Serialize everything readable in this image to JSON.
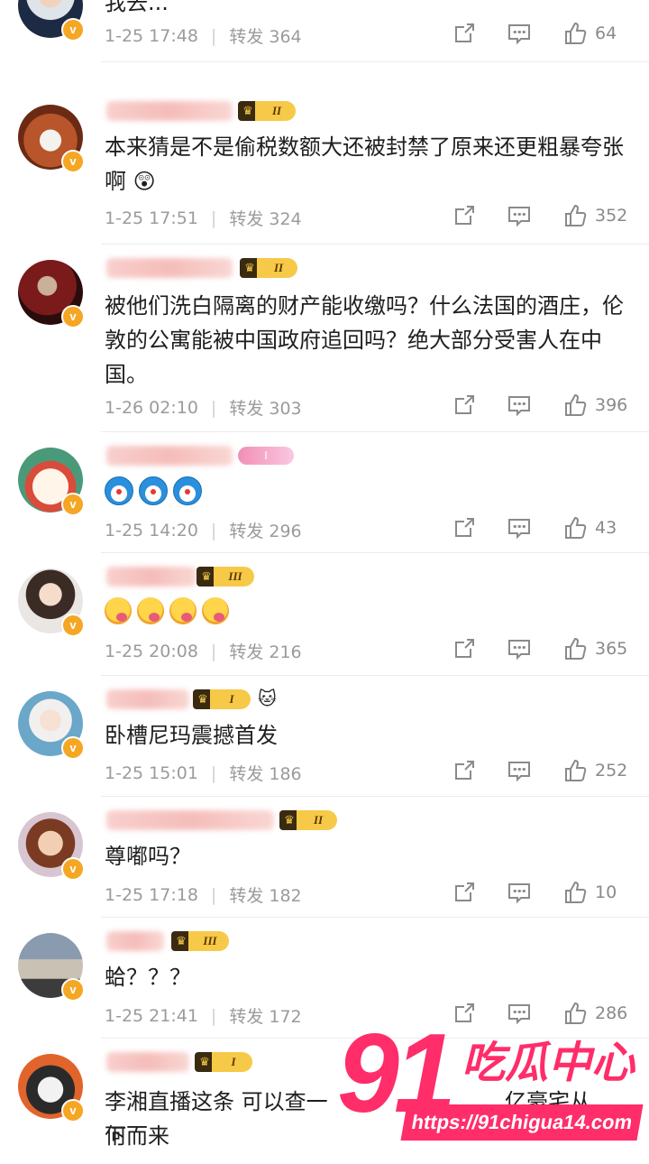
{
  "comments": [
    {
      "text": "我去...",
      "time": "1-25 17:48",
      "repost": "转发 364",
      "likes": "64",
      "avatar": "avatar-suit-man",
      "badge": null,
      "emojis": []
    },
    {
      "text": "本来猜是不是偷税数额大还被封禁了原来还更粗暴夸张啊",
      "time": "1-25 17:51",
      "repost": "转发 324",
      "likes": "352",
      "avatar": "avatar-red-panda",
      "badge": "II",
      "emojis": []
    },
    {
      "text": "被他们洗白隔离的财产能收缴吗？什么法国的酒庄，伦敦的公寓能被中国政府追回吗？绝大部分受害人在中国。",
      "time": "1-26 02:10",
      "repost": "转发 303",
      "likes": "396",
      "avatar": "avatar-red-figure",
      "badge": "II",
      "emojis": []
    },
    {
      "text": "",
      "time": "1-25 14:20",
      "repost": "转发 296",
      "likes": "43",
      "avatar": "avatar-cartoon-cat",
      "badge": "I",
      "emojis": [
        "doraemon",
        "doraemon",
        "doraemon"
      ]
    },
    {
      "text": "",
      "time": "1-25 20:08",
      "repost": "转发 216",
      "likes": "365",
      "avatar": "avatar-girl-white",
      "badge": "III",
      "emojis": [
        "yum",
        "yum",
        "yum",
        "yum"
      ]
    },
    {
      "text": "卧槽尼玛震撼首发",
      "time": "1-25 15:01",
      "repost": "转发 186",
      "likes": "252",
      "avatar": "avatar-girl-hat",
      "badge": "I",
      "emojis": []
    },
    {
      "text": "尊嘟吗？",
      "time": "1-25 17:18",
      "repost": "转发 182",
      "likes": "10",
      "avatar": "avatar-anime-boy",
      "badge": "II",
      "emojis": []
    },
    {
      "text": "蛤？？？",
      "time": "1-25 21:41",
      "repost": "转发 172",
      "likes": "286",
      "avatar": "avatar-house",
      "badge": "III",
      "emojis": []
    },
    {
      "text": "李湘直播这条 可以查一下",
      "time": "",
      "repost": "",
      "likes": "",
      "avatar": "avatar-penguin",
      "badge": "I",
      "emojis": []
    }
  ],
  "last_comment_line2": "何而来",
  "last_comment_tail": "亿豪宅从",
  "watermark": {
    "number": "91",
    "name": "吃瓜中心",
    "url": "https://91chigua14.com"
  },
  "colors": {
    "verified_badge": "#f5a623",
    "watermark": "#ff2d6a",
    "meta_gray": "#9b9b9b"
  }
}
